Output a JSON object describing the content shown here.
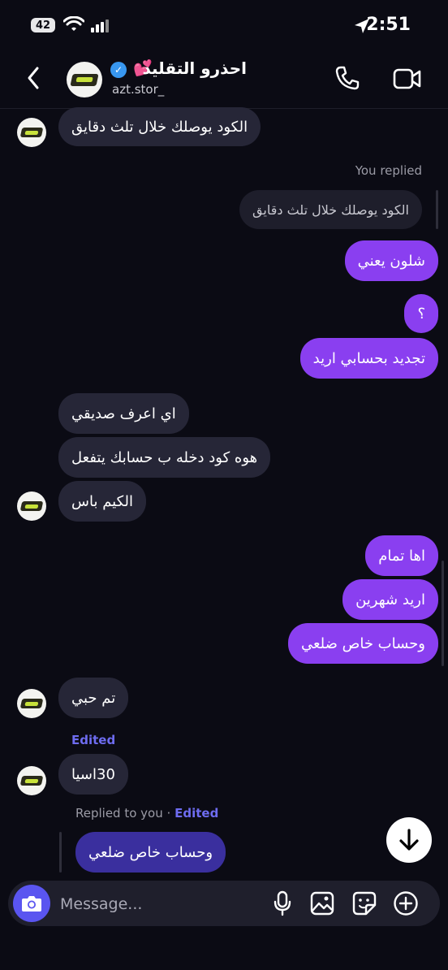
{
  "status_bar": {
    "time": "2:51",
    "battery": "42"
  },
  "header": {
    "name": "احذرو التقليد",
    "heart": "💕",
    "username": "azt.stor_"
  },
  "messages": {
    "m1": "الكود يوصلك خلال تلث دقايق",
    "you_replied": "You replied",
    "quoted": "الكود يوصلك خلال تلث دقايق",
    "m2": "شلون يعني",
    "m3": "؟",
    "m4": "تجديد بحسابي اريد",
    "m5": "اي اعرف صديقي",
    "m6": "هوه كود دخله ب حسابك يتفعل",
    "m7": "الكيم باس",
    "m8": "اها تمام",
    "m9": "اريد شهرين",
    "m10": "وحساب خاص ضلعي",
    "m11": "تم حبي",
    "edited1": "Edited",
    "m12": "30اسيا",
    "replied_to_you": "Replied to you",
    "dot": "·",
    "edited2": "Edited",
    "reply_quote": "وحساب خاص ضلعي"
  },
  "composer": {
    "placeholder": "Message..."
  },
  "colors": {
    "background": "#0b0b14",
    "outgoing": "#8a3ff0",
    "incoming": "#262637",
    "accent": "#5a55f0",
    "edited": "#6e6cf0"
  }
}
